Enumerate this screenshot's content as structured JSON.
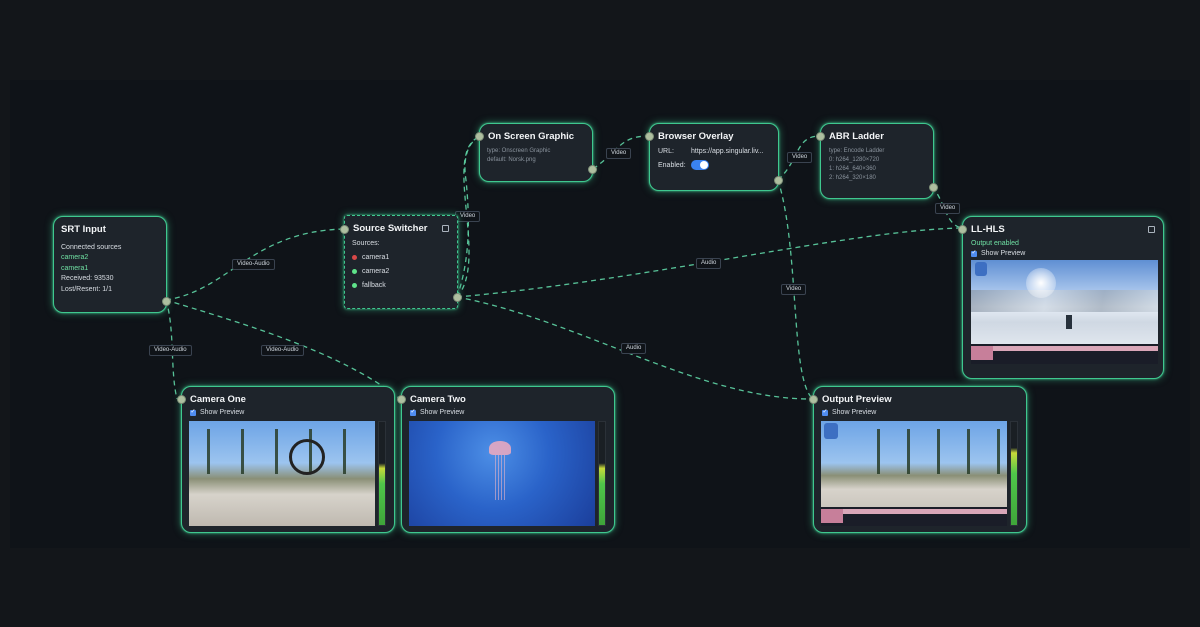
{
  "nodes": {
    "srt": {
      "title": "SRT Input",
      "connected": "Connected sources",
      "source1": "camera2",
      "source2": "camera1",
      "received": "Received: 93530",
      "lost": "Lost/Resent: 1/1"
    },
    "switcher": {
      "title": "Source Switcher",
      "sources_label": "Sources:",
      "items": [
        "camera1",
        "camera2",
        "fallback"
      ]
    },
    "osg": {
      "title": "On Screen Graphic",
      "type": "type: Onscreen Graphic",
      "default": "default: Norsk.png"
    },
    "browser": {
      "title": "Browser Overlay",
      "url_label": "URL:",
      "url_value": "https://app.singular.liv...",
      "enabled_label": "Enabled:"
    },
    "abr": {
      "title": "ABR Ladder",
      "type": "type: Encode Ladder",
      "rung0": "0: h264_1280×720",
      "rung1": "1: h264_640×360",
      "rung2": "2: h264_320×180"
    },
    "llhls": {
      "title": "LL-HLS",
      "status": "Output enabled",
      "show_preview": "Show Preview"
    },
    "cam1": {
      "title": "Camera One",
      "show_preview": "Show Preview"
    },
    "cam2": {
      "title": "Camera Two",
      "show_preview": "Show Preview"
    },
    "output": {
      "title": "Output Preview",
      "show_preview": "Show Preview"
    }
  },
  "edges": {
    "srt_switcher": "Video-Audio",
    "srt_cam1": "Video-Audio",
    "srt_cam2": "Video-Audio",
    "switcher_osg": "Video",
    "osg_browser": "Video",
    "browser_abr": "Video",
    "abr_hls": "Video",
    "switcher_hls": "Audio",
    "switcher_output": "Audio",
    "browser_output": "Video"
  },
  "colors": {
    "accent": "#3fc88f",
    "edge": "#5fd6a6",
    "background": "#0f1318",
    "node": "#1e242b",
    "status_red": "#d94848",
    "status_green": "#5fe38a",
    "toggle": "#3a82f0"
  }
}
